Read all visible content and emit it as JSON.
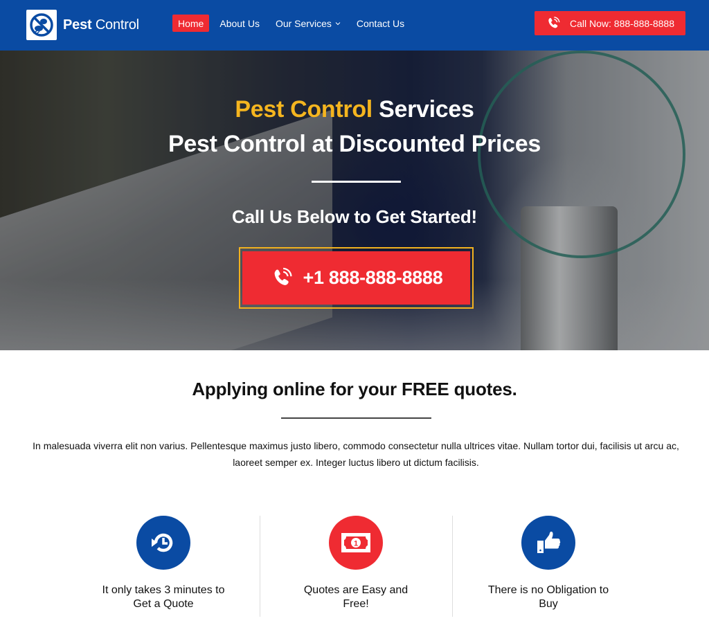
{
  "header": {
    "logo": {
      "icon": "no-pest-icon",
      "bold": "Pest",
      "regular": "Control"
    },
    "nav": [
      {
        "label": "Home",
        "active": true
      },
      {
        "label": "About Us",
        "active": false
      },
      {
        "label": "Our Services",
        "active": false,
        "has_dropdown": true
      },
      {
        "label": "Contact Us",
        "active": false
      }
    ],
    "call_now": {
      "icon": "phone-ringing-icon",
      "label": "Call Now: 888-888-8888"
    }
  },
  "hero": {
    "line1": {
      "highlight": "Pest Control",
      "rest": " Services"
    },
    "line2": {
      "bold": "Pest Control",
      "rest": " at Discounted Prices"
    },
    "line3": {
      "bold": "Call Us Below",
      "rest": " to Get Started!"
    },
    "cta": {
      "icon": "phone-ringing-icon",
      "label": "+1 888-888-8888"
    }
  },
  "intro": {
    "title_regular": "Applying online for your ",
    "title_bold": "FREE quotes.",
    "text": "In malesuada viverra elit non varius. Pellentesque maximus justo libero, commodo consectetur nulla ultrices vitae. Nullam tortor dui, facilisis ut arcu ac, laoreet semper ex. Integer luctus libero ut dictum facilisis."
  },
  "features": [
    {
      "icon": "history-clock-icon",
      "label": "It only takes 3 minutes to Get a Quote",
      "color": "#0a4ba3"
    },
    {
      "icon": "money-bill-icon",
      "label": "Quotes are Easy and Free!",
      "color": "#ef2b32"
    },
    {
      "icon": "thumbs-up-icon",
      "label": "There is no Obligation to Buy",
      "color": "#0a4ba3"
    }
  ],
  "colors": {
    "brand_blue": "#0a4ba3",
    "accent_red": "#ef2b32",
    "accent_gold": "#f5b51f"
  }
}
